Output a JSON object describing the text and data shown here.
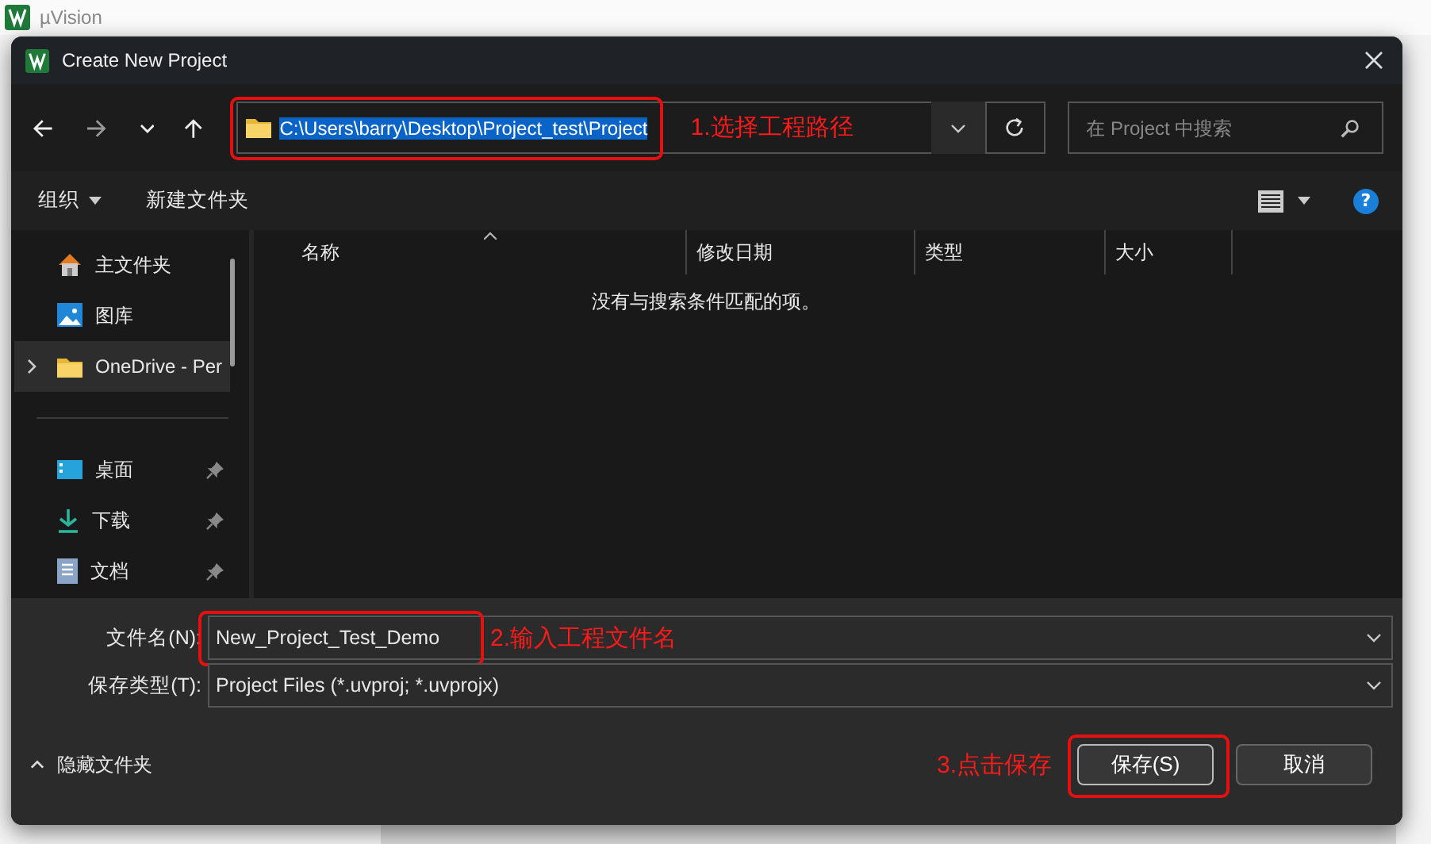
{
  "app": {
    "title": "µVision"
  },
  "dialog": {
    "title": "Create New Project"
  },
  "address": {
    "value": "C:\\Users\\barry\\Desktop\\Project_test\\Project",
    "selected": true
  },
  "search": {
    "placeholder": "在 Project 中搜索"
  },
  "help": "?",
  "commands": [
    {
      "label": "组织",
      "kind": "menu"
    },
    {
      "label": "新建文件夹",
      "kind": "plain"
    }
  ],
  "sidebar": {
    "groups": [
      [
        {
          "label": "主文件夹",
          "kind": "home",
          "selected": false,
          "pinned": false
        },
        {
          "label": "图库",
          "kind": "gallery",
          "selected": false,
          "pinned": false
        },
        {
          "label": "OneDrive - Per",
          "kind": "folder",
          "selected": true,
          "pinned": false
        }
      ],
      [
        {
          "label": "桌面",
          "kind": "desktop",
          "selected": false,
          "pinned": true
        },
        {
          "label": "下载",
          "kind": "download",
          "selected": false,
          "pinned": true
        },
        {
          "label": "文档",
          "kind": "document",
          "selected": false,
          "pinned": true
        }
      ]
    ]
  },
  "columns": [
    "名称",
    "修改日期",
    "类型",
    "大小"
  ],
  "empty_message": "没有与搜索条件匹配的项。",
  "file_name": {
    "label": "文件名(N):",
    "value": "New_Project_Test_Demo"
  },
  "file_type": {
    "label": "保存类型(T):",
    "value": "Project Files (*.uvproj; *.uvprojx)"
  },
  "hide_folders": "隐藏文件夹",
  "buttons": [
    {
      "label": "保存(S)",
      "kind": "primary"
    },
    {
      "label": "取消",
      "kind": "secondary"
    }
  ],
  "annotations": [
    "1.选择工程路径",
    "2.输入工程文件名",
    "3.点击保存"
  ]
}
